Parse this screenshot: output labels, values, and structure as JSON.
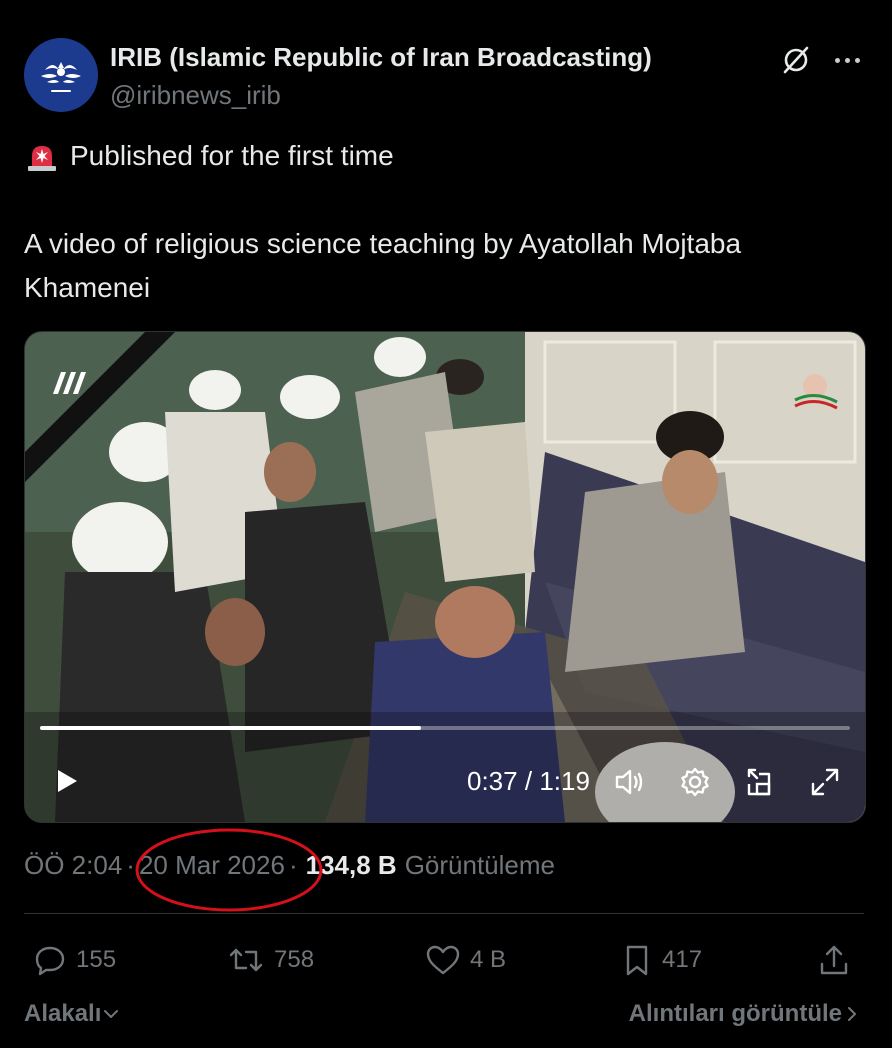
{
  "author": {
    "name": "IRIB (Islamic Republic of Iran Broadcasting)",
    "handle": "@iribnews_irib",
    "avatar_icon": "irib-logo-icon",
    "avatar_color": "#1c3b8f"
  },
  "header_icons": [
    "grok-icon",
    "more-options-icon"
  ],
  "tweet": {
    "icon": "rotating-light-siren-icon",
    "line1": "Published for the first time",
    "body": "A video of religious science teaching by Ayatollah Mojtaba Khamenei"
  },
  "video": {
    "current_time": "0:37",
    "separator": "/",
    "duration": "1:19",
    "progress_fraction": 0.47,
    "controls": [
      "play-icon",
      "volume-icon",
      "settings-gear-icon",
      "pip-icon",
      "fullscreen-icon"
    ]
  },
  "meta": {
    "time": "ÖÖ 2:04",
    "dot1": "·",
    "date": "20 Mar 2026",
    "dot2": "·",
    "views_count": "134,8 B",
    "views_label": "Görüntüleme",
    "annotation_color": "#d4101a"
  },
  "actions": {
    "replies": "155",
    "reposts": "758",
    "likes": "4 B",
    "bookmarks": "417"
  },
  "footer": {
    "sort_label": "Alakalı",
    "quotes_label": "Alıntıları görüntüle"
  },
  "colors": {
    "background": "#000000",
    "text": "#e7e9ea",
    "muted": "#71767b",
    "border": "#2f3336"
  }
}
